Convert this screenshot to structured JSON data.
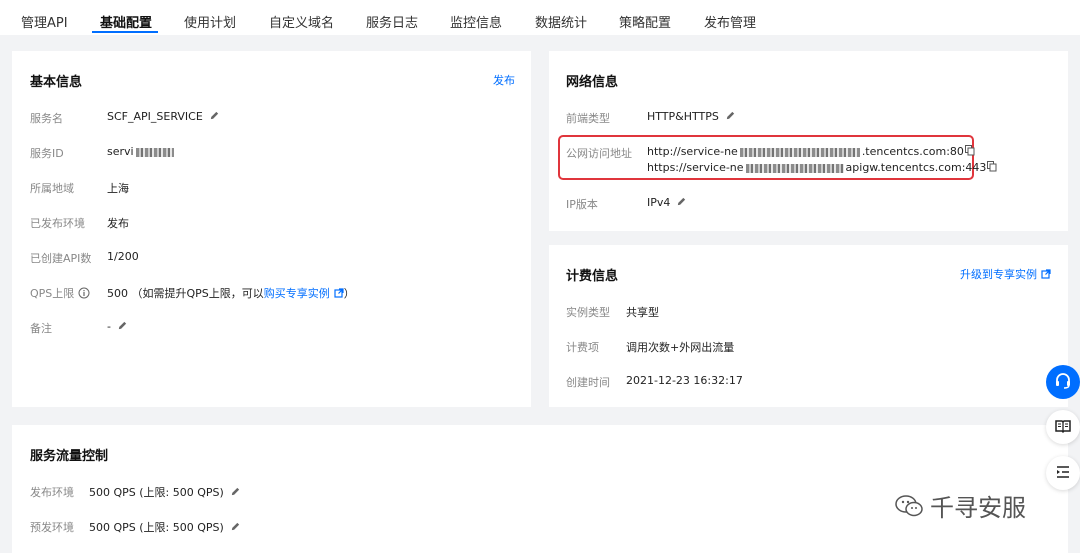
{
  "tabs": [
    "管理API",
    "基础配置",
    "使用计划",
    "自定义域名",
    "服务日志",
    "监控信息",
    "数据统计",
    "策略配置",
    "发布管理"
  ],
  "basic": {
    "title": "基本信息",
    "publish_link": "发布",
    "service_name_label": "服务名",
    "service_name": "SCF_API_SERVICE",
    "service_id_label": "服务ID",
    "service_id": "servi",
    "region_label": "所属地域",
    "region": "上海",
    "env_label": "已发布环境",
    "env": "发布",
    "api_count_label": "已创建API数",
    "api_count": "1/200",
    "qps_label": "QPS上限",
    "qps_value": "500",
    "qps_note_before": "（如需提升QPS上限，可以",
    "qps_note_link": "购买专享实例",
    "qps_note_after": "）",
    "remark_label": "备注",
    "remark": "-"
  },
  "network": {
    "title": "网络信息",
    "frontend_label": "前端类型",
    "frontend": "HTTP&HTTPS",
    "public_label": "公网访问地址",
    "http_prefix": "http://service-ne",
    "http_suffix": ".tencentcs.com:80",
    "https_prefix": "https://service-ne",
    "https_suffix": "apigw.tencentcs.com:443",
    "ip_label": "IP版本",
    "ip": "IPv4"
  },
  "billing": {
    "title": "计费信息",
    "upgrade_link": "升级到专享实例",
    "instance_label": "实例类型",
    "instance": "共享型",
    "billing_label": "计费项",
    "billing": "调用次数+外网出流量",
    "created_label": "创建时间",
    "created": "2021-12-23 16:32:17"
  },
  "traffic": {
    "title": "服务流量控制",
    "release_label": "发布环境",
    "release": "500 QPS (上限: 500 QPS)",
    "prerelease_label": "预发环境",
    "prerelease": "500 QPS (上限: 500 QPS)"
  },
  "watermark": "千寻安服",
  "colors": {
    "accent": "#006eff",
    "highlight": "#e0353c"
  }
}
